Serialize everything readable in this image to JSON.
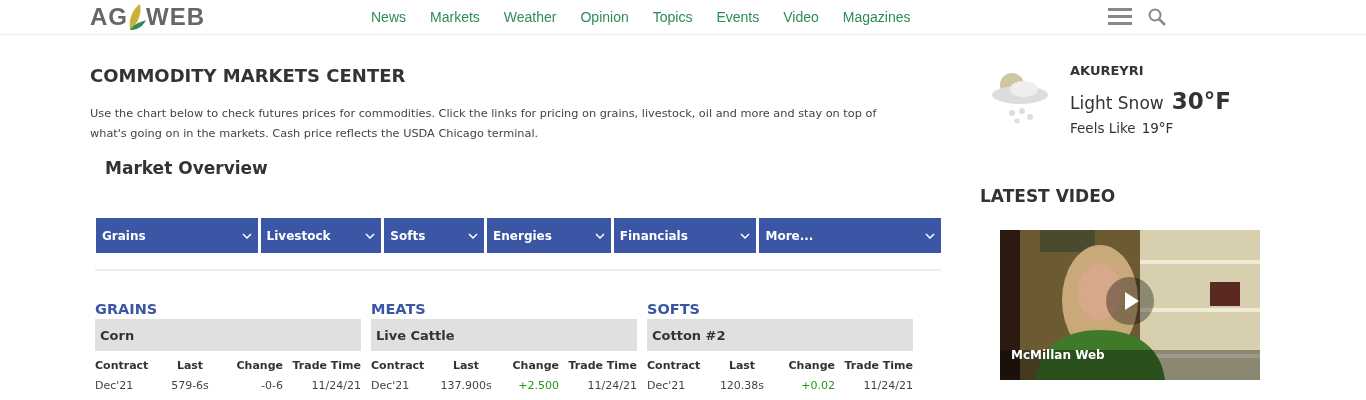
{
  "header": {
    "logo": {
      "left": "AG",
      "right": "WEB"
    },
    "nav": [
      "News",
      "Markets",
      "Weather",
      "Opinion",
      "Topics",
      "Events",
      "Video",
      "Magazines"
    ]
  },
  "main": {
    "title": "COMMODITY MARKETS CENTER",
    "intro": "Use the chart below to check futures prices for commodities. Click the links for pricing on grains, livestock, oil and more and stay on top of what's going on in the markets. Cash price reflects the USDA Chicago terminal.",
    "overview_title": "Market Overview",
    "dropdowns": [
      "Grains",
      "Livestock",
      "Softs",
      "Energies",
      "Financials",
      "More..."
    ],
    "sections": [
      {
        "heading": "GRAINS",
        "commodity": "Corn",
        "columns": [
          "Contract",
          "Last",
          "Change",
          "Trade Time"
        ],
        "rows": [
          {
            "contract": "Dec'21",
            "last": "579-6s",
            "change": "-0-6",
            "color": "#444444",
            "time": "11/24/21"
          }
        ]
      },
      {
        "heading": "MEATS",
        "commodity": "Live Cattle",
        "columns": [
          "Contract",
          "Last",
          "Change",
          "Trade Time"
        ],
        "rows": [
          {
            "contract": "Dec'21",
            "last": "137.900s",
            "change": "+2.500",
            "color": "#1a9a1a",
            "time": "11/24/21"
          }
        ]
      },
      {
        "heading": "SOFTS",
        "commodity": "Cotton #2",
        "columns": [
          "Contract",
          "Last",
          "Change",
          "Trade Time"
        ],
        "rows": [
          {
            "contract": "Dec'21",
            "last": "120.38s",
            "change": "+0.02",
            "color": "#1a9a1a",
            "time": "11/24/21"
          }
        ]
      }
    ]
  },
  "weather": {
    "city": "AKUREYRI",
    "condition": "Light Snow",
    "temperature": "30°F",
    "feels_label": "Feels Like",
    "feels_value": "19°F"
  },
  "latest_video": {
    "title": "LATEST VIDEO",
    "video": {
      "kind": "picture",
      "caption": "McMillan Web"
    }
  }
}
